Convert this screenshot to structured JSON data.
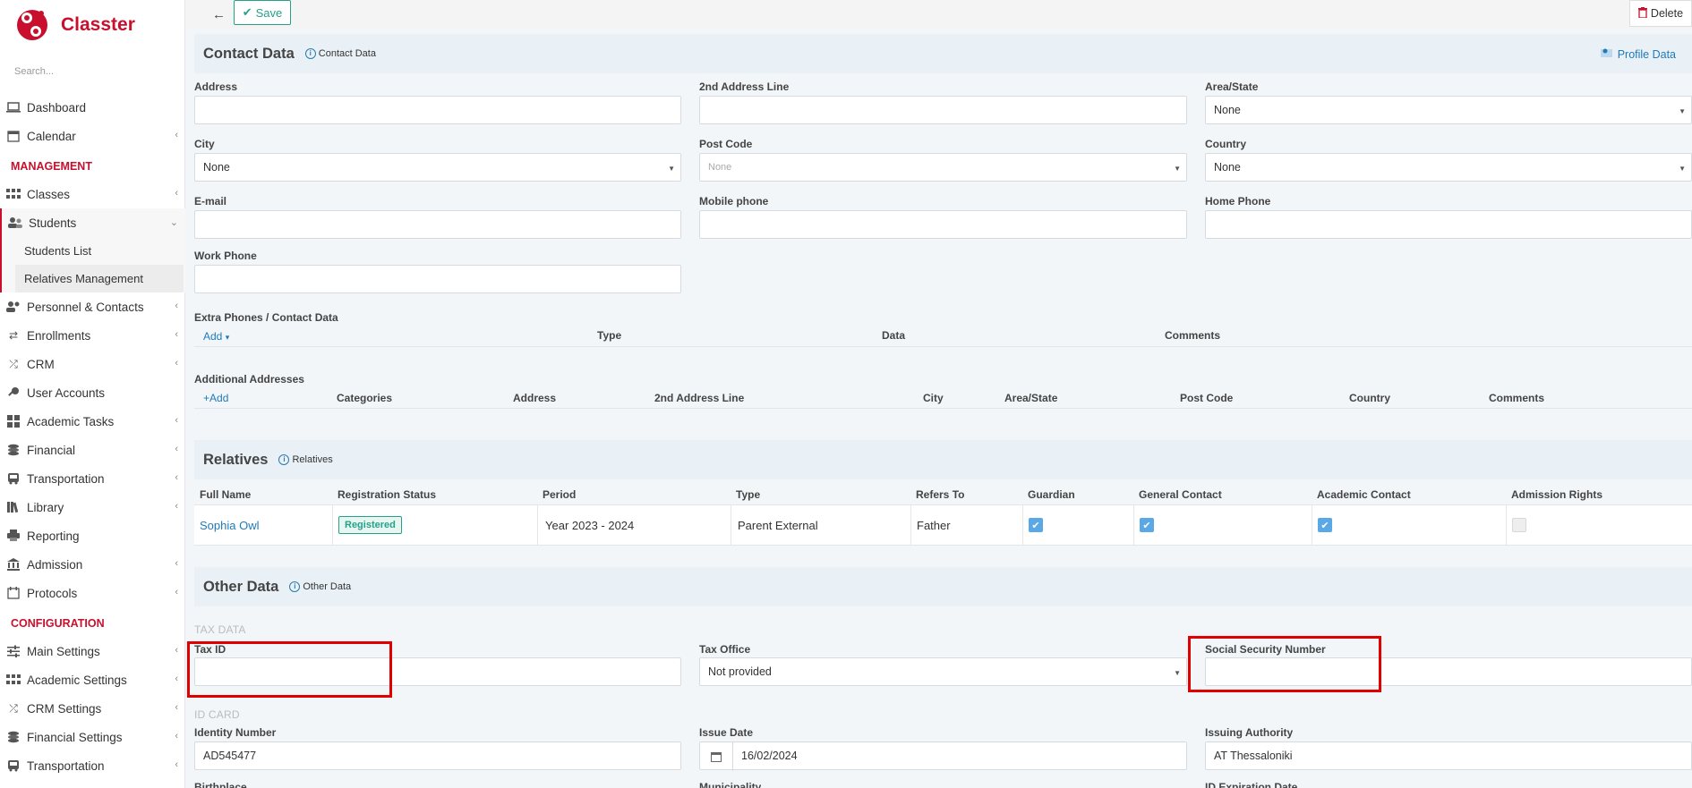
{
  "app": {
    "name": "Classter",
    "brand_color": "#c8102e",
    "accent_color": "#27a08a",
    "link_color": "#1f7ab8"
  },
  "sidebar": {
    "search_placeholder": "Search...",
    "items": [
      {
        "label": "Dashboard",
        "icon": "laptop-icon"
      },
      {
        "label": "Calendar",
        "icon": "calendar-icon"
      }
    ],
    "management_title": "MANAGEMENT",
    "management_items": [
      {
        "label": "Classes",
        "icon": "classes-icon"
      },
      {
        "label": "Students",
        "icon": "students-icon"
      }
    ],
    "students_sub": [
      "Students List",
      "Relatives Management"
    ],
    "management_items_2": [
      {
        "label": "Personnel & Contacts",
        "icon": "personnel-icon"
      },
      {
        "label": "Enrollments",
        "icon": "enrollments-icon"
      },
      {
        "label": "CRM",
        "icon": "crm-icon"
      },
      {
        "label": "User Accounts",
        "icon": "key-icon"
      },
      {
        "label": "Academic Tasks",
        "icon": "grid-icon"
      },
      {
        "label": "Financial",
        "icon": "coins-icon"
      },
      {
        "label": "Transportation",
        "icon": "bus-icon"
      },
      {
        "label": "Library",
        "icon": "books-icon"
      },
      {
        "label": "Reporting",
        "icon": "printer-icon"
      },
      {
        "label": "Admission",
        "icon": "institution-icon"
      },
      {
        "label": "Protocols",
        "icon": "protocols-icon"
      }
    ],
    "configuration_title": "CONFIGURATION",
    "configuration_items": [
      {
        "label": "Main Settings",
        "icon": "sliders-icon"
      },
      {
        "label": "Academic Settings",
        "icon": "classes-icon"
      },
      {
        "label": "CRM Settings",
        "icon": "crm-icon"
      },
      {
        "label": "Financial Settings",
        "icon": "coins-icon"
      },
      {
        "label": "Transportation",
        "icon": "bus-icon"
      }
    ]
  },
  "toolbar": {
    "save_label": "Save",
    "delete_label": "Delete"
  },
  "contact": {
    "title": "Contact Data",
    "info": "Contact Data",
    "profile_link": "Profile Data",
    "fields": {
      "address": {
        "label": "Address",
        "value": ""
      },
      "address2": {
        "label": "2nd Address Line",
        "value": ""
      },
      "area": {
        "label": "Area/State",
        "value": "None"
      },
      "city": {
        "label": "City",
        "value": "None"
      },
      "postcode": {
        "label": "Post Code",
        "value": "None"
      },
      "country": {
        "label": "Country",
        "value": "None"
      },
      "email": {
        "label": "E-mail",
        "value": ""
      },
      "mobile": {
        "label": "Mobile phone",
        "value": ""
      },
      "home": {
        "label": "Home Phone",
        "value": ""
      },
      "work": {
        "label": "Work Phone",
        "value": ""
      }
    },
    "extra_phones": {
      "title": "Extra Phones / Contact Data",
      "add": "Add",
      "columns": [
        "Type",
        "Data",
        "Comments"
      ]
    },
    "addresses": {
      "title": "Additional Addresses",
      "add": "Add",
      "columns": [
        "Categories",
        "Address",
        "2nd Address Line",
        "City",
        "Area/State",
        "Post Code",
        "Country",
        "Comments"
      ]
    }
  },
  "relatives": {
    "title": "Relatives",
    "info": "Relatives",
    "columns": [
      "Full Name",
      "Registration Status",
      "Period",
      "Type",
      "Refers To",
      "Guardian",
      "General Contact",
      "Academic Contact",
      "Admission Rights"
    ],
    "rows": [
      {
        "name": "Sophia Owl",
        "status": "Registered",
        "period": "Year 2023 - 2024",
        "type": "Parent External",
        "refers_to": "Father",
        "guardian": true,
        "general_contact": true,
        "academic_contact": true,
        "admission_rights": false
      }
    ]
  },
  "other": {
    "title": "Other Data",
    "info": "Other Data",
    "tax_group": "TAX DATA",
    "tax_id": {
      "label": "Tax ID",
      "value": ""
    },
    "tax_office": {
      "label": "Tax Office",
      "value": "Not provided"
    },
    "ssn": {
      "label": "Social Security Number",
      "value": ""
    },
    "id_group": "ID CARD",
    "identity_number": {
      "label": "Identity Number",
      "value": "AD545477"
    },
    "issue_date": {
      "label": "Issue Date",
      "value": "16/02/2024"
    },
    "issuing_authority": {
      "label": "Issuing Authority",
      "value": "AT Thessaloniki"
    },
    "cut_labels": [
      "Birthplace",
      "Municipality",
      "ID Expiration Date"
    ]
  }
}
